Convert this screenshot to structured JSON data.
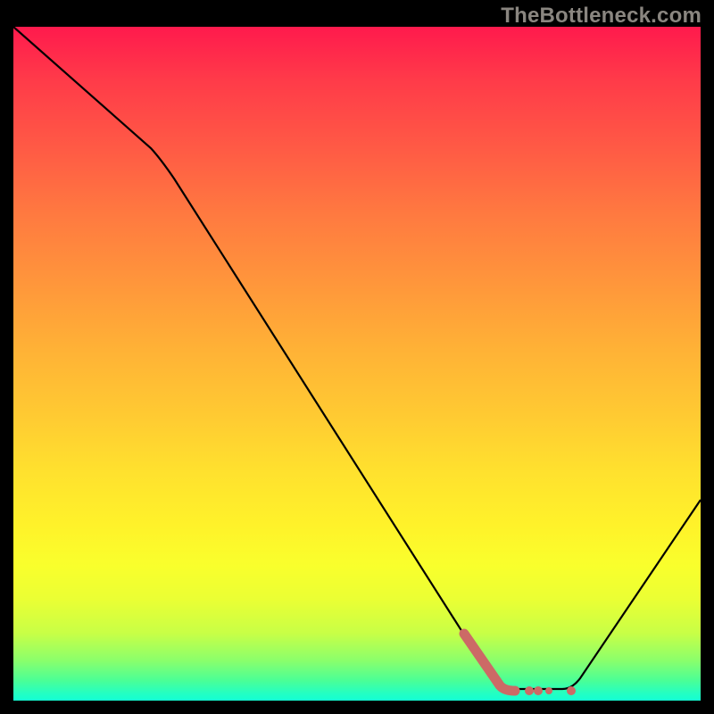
{
  "watermark": "TheBottleneck.com",
  "chart_data": {
    "type": "line",
    "title": "",
    "xlabel": "",
    "ylabel": "",
    "x_range": [
      0,
      100
    ],
    "y_range": [
      0,
      100
    ],
    "series": [
      {
        "name": "curve",
        "points": [
          [
            0,
            100
          ],
          [
            20,
            82
          ],
          [
            70,
            3
          ],
          [
            80,
            3
          ],
          [
            100,
            30
          ]
        ]
      }
    ],
    "highlight_segment": {
      "start_x": 65,
      "end_x": 73,
      "color": "#cc6a66"
    },
    "highlight_dots": [
      {
        "x": 76,
        "color": "#cc6a66"
      },
      {
        "x": 78,
        "color": "#cc6a66"
      },
      {
        "x": 82,
        "color": "#cc6a66"
      }
    ],
    "background_gradient": {
      "top": "#ff1a4d",
      "mid": "#ffe12e",
      "bottom": "#14ffd4"
    }
  }
}
